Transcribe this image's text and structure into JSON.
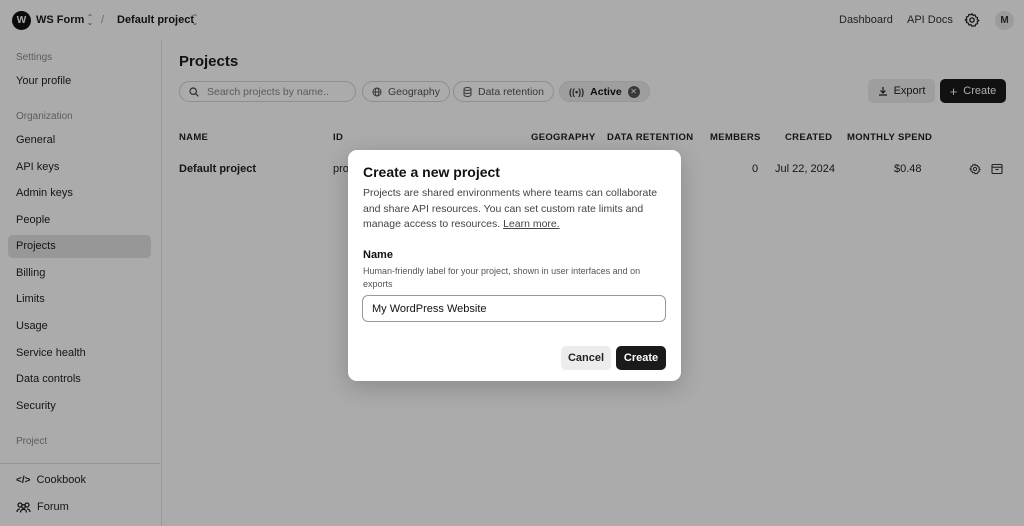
{
  "topbar": {
    "org_initial": "W",
    "org_name": "WS Form",
    "separator": "/",
    "project_name": "Default project",
    "links": [
      "Dashboard",
      "API Docs"
    ],
    "user_initial": "M"
  },
  "sidebar": {
    "settings_heading": "Settings",
    "your_profile": "Your profile",
    "org_heading": "Organization",
    "items": [
      "General",
      "API keys",
      "Admin keys",
      "People",
      "Projects",
      "Billing",
      "Limits",
      "Usage",
      "Service health",
      "Data controls",
      "Security"
    ],
    "active_item": "Projects",
    "project_heading": "Project",
    "bottom": [
      "Cookbook",
      "Forum"
    ]
  },
  "main": {
    "title": "Projects",
    "search_placeholder": "Search projects by name..",
    "filters": [
      "Geography",
      "Data retention"
    ],
    "active_filter": "Active",
    "export_label": "Export",
    "create_label": "Create",
    "columns": [
      "NAME",
      "ID",
      "GEOGRAPHY",
      "DATA RETENTION",
      "MEMBERS",
      "CREATED",
      "MONTHLY SPEND"
    ],
    "rows": [
      {
        "name": "Default project",
        "id": "proj",
        "members": "0",
        "created": "Jul 22, 2024",
        "spend": "$0.48"
      }
    ]
  },
  "modal": {
    "title": "Create a new project",
    "description": "Projects are shared environments where teams can collaborate and share API resources. You can set custom rate limits and manage access to resources.",
    "learn_more": "Learn more.",
    "name_label": "Name",
    "name_help": "Human-friendly label for your project, shown in user interfaces and on exports",
    "name_value": "My WordPress Website",
    "cancel_label": "Cancel",
    "create_label": "Create"
  }
}
